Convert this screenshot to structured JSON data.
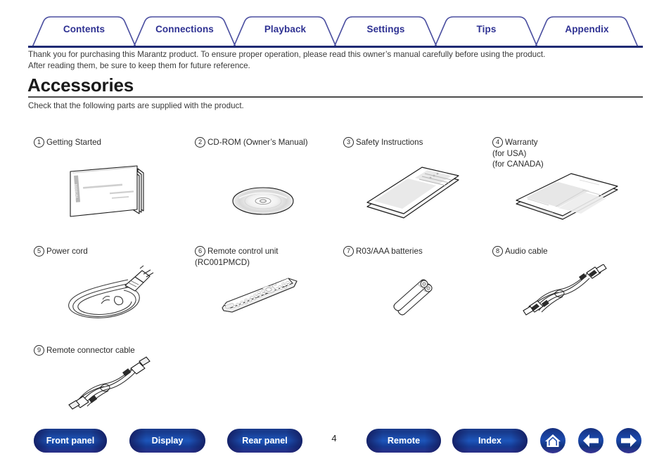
{
  "nav": {
    "tabs": [
      {
        "label": "Contents"
      },
      {
        "label": "Connections"
      },
      {
        "label": "Playback"
      },
      {
        "label": "Settings"
      },
      {
        "label": "Tips"
      },
      {
        "label": "Appendix"
      }
    ]
  },
  "intro": {
    "line1": "Thank you for purchasing this Marantz product. To ensure proper operation, please read this owner’s manual carefully before using the product.",
    "line2": "After reading them, be sure to keep them for future reference."
  },
  "heading": "Accessories",
  "subtext": "Check that the following parts are supplied with the product.",
  "accessories": [
    {
      "num": "1",
      "label": "Getting Started",
      "art": "booklet"
    },
    {
      "num": "2",
      "label": "CD-ROM (Owner’s Manual)",
      "art": "cd-rom"
    },
    {
      "num": "3",
      "label": "Safety Instructions",
      "art": "sheet"
    },
    {
      "num": "4",
      "label": "Warranty\n(for USA)\n(for CANADA)",
      "art": "warranty"
    },
    {
      "num": "5",
      "label": "Power cord",
      "art": "power-cord"
    },
    {
      "num": "6",
      "label": "Remote control unit\n(RC001PMCD)",
      "art": "remote"
    },
    {
      "num": "7",
      "label": "R03/AAA batteries",
      "art": "batteries"
    },
    {
      "num": "8",
      "label": "Audio cable",
      "art": "audio-cable"
    },
    {
      "num": "9",
      "label": "Remote connector cable",
      "art": "connector-cable"
    }
  ],
  "footer": {
    "buttons": [
      {
        "label": "Front panel"
      },
      {
        "label": "Display"
      },
      {
        "label": "Rear panel"
      },
      {
        "label": "Remote"
      },
      {
        "label": "Index"
      }
    ],
    "page_number": "4",
    "icons": [
      {
        "name": "home-icon"
      },
      {
        "name": "arrow-left-icon"
      },
      {
        "name": "arrow-right-icon"
      }
    ]
  },
  "colors": {
    "accent_blue": "#2e3192",
    "tab_border": "#4b4fa0",
    "rule_navy": "#1f2a74",
    "button_blue": "#1b49ad"
  }
}
